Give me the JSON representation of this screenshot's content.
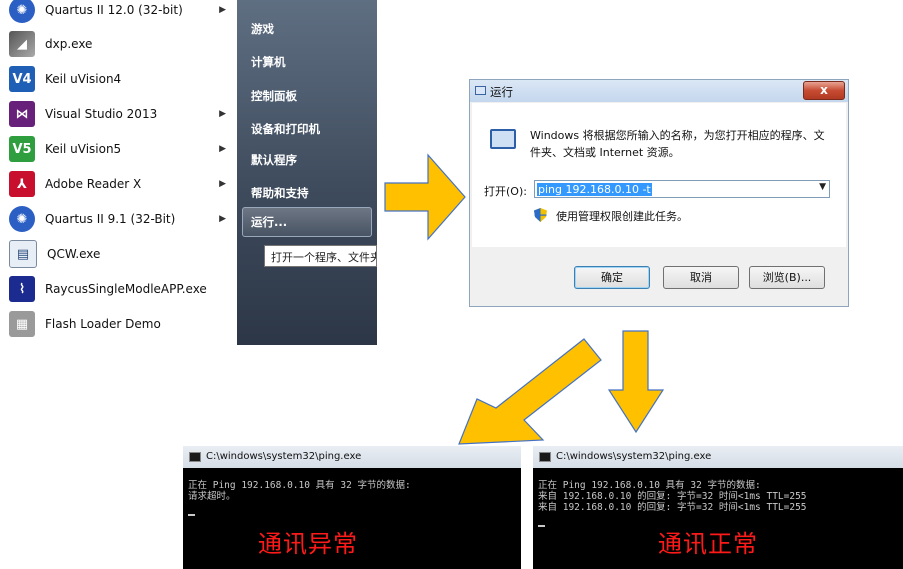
{
  "start_menu": {
    "programs": [
      {
        "label": "Quartus II 12.0 (32-bit)",
        "icon": "quartus-icon",
        "has_submenu": true
      },
      {
        "label": "dxp.exe",
        "icon": "dxp-icon",
        "has_submenu": false
      },
      {
        "label": "Keil uVision4",
        "icon": "keil-uvision4-icon",
        "icon_text": "V4",
        "has_submenu": false
      },
      {
        "label": "Visual Studio 2013",
        "icon": "visual-studio-icon",
        "has_submenu": true
      },
      {
        "label": "Keil uVision5",
        "icon": "keil-uvision5-icon",
        "icon_text": "V5",
        "has_submenu": true
      },
      {
        "label": "Adobe Reader X",
        "icon": "adobe-reader-icon",
        "has_submenu": true
      },
      {
        "label": "Quartus II 9.1 (32-Bit)",
        "icon": "quartus-icon",
        "has_submenu": true
      },
      {
        "label": "QCW.exe",
        "icon": "qcw-icon",
        "has_submenu": false
      },
      {
        "label": "RaycusSingleModleAPP.exe",
        "icon": "raycus-icon",
        "has_submenu": false
      },
      {
        "label": "Flash Loader Demo",
        "icon": "chip-icon",
        "has_submenu": false
      }
    ],
    "right_items": [
      "游戏",
      "计算机",
      "控制面板",
      "设备和打印机",
      "默认程序",
      "帮助和支持",
      "运行..."
    ],
    "tooltip": "打开一个程序、文件夹"
  },
  "run_dialog": {
    "title": "运行",
    "close_label": "x",
    "description": "Windows 将根据您所输入的名称，为您打开相应的程序、文件夹、文档或 Internet 资源。",
    "open_label": "打开(O):",
    "open_value": "ping 192.168.0.10 -t",
    "admin_note": "使用管理权限创建此任务。",
    "ok_label": "确定",
    "cancel_label": "取消",
    "browse_label": "浏览(B)..."
  },
  "console_fail": {
    "title": "C:\\windows\\system32\\ping.exe",
    "lines": [
      "正在 Ping 192.168.0.10 具有 32 字节的数据:",
      "请求超时。"
    ],
    "status": "通讯异常"
  },
  "console_ok": {
    "title": "C:\\windows\\system32\\ping.exe",
    "lines": [
      "正在 Ping 192.168.0.10 具有 32 字节的数据:",
      "来自 192.168.0.10 的回复: 字节=32 时间<1ms TTL=255",
      "来自 192.168.0.10 的回复: 字节=32 时间<1ms TTL=255"
    ],
    "status": "通讯正常"
  },
  "colors": {
    "arrow_fill": "#ffc000",
    "arrow_stroke": "#4472c4",
    "status_text": "#ff1a1a"
  }
}
